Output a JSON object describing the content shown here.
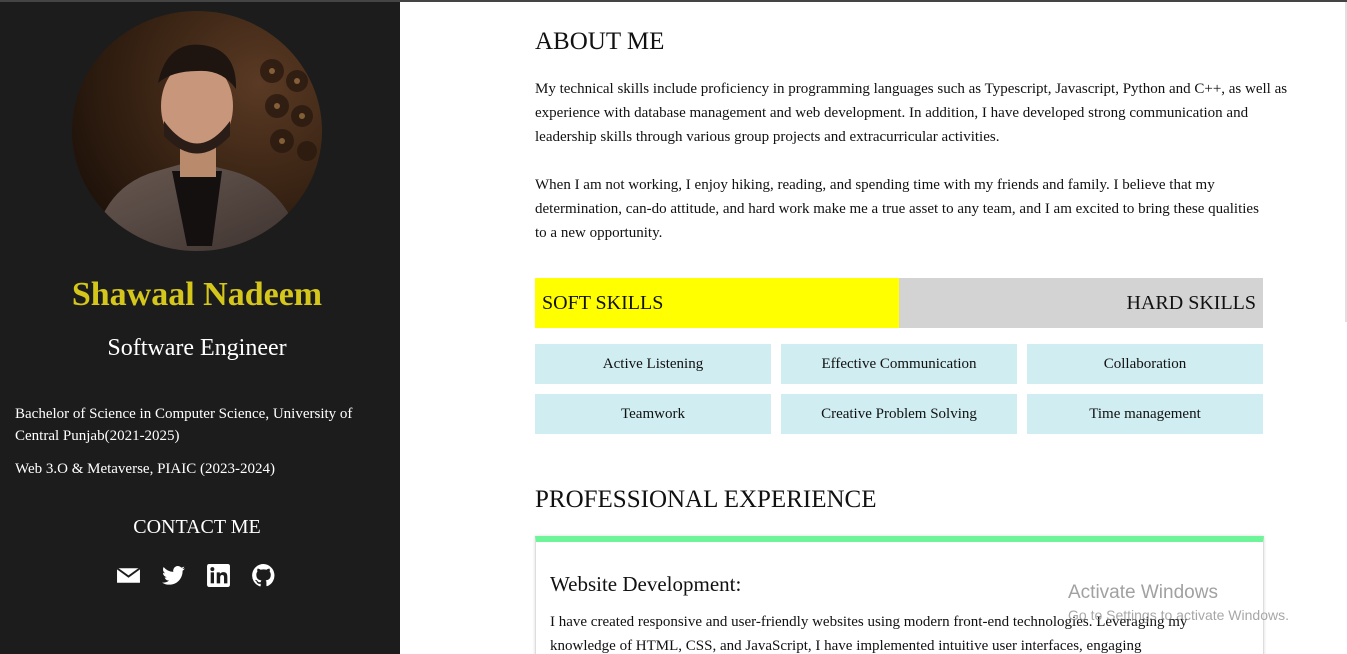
{
  "profile": {
    "name": "Shawaal Nadeem",
    "role": "Software Engineer",
    "education": [
      "Bachelor of Science in Computer Science, University of Central Punjab(2021-2025)",
      "Web 3.O & Metaverse, PIAIC (2023-2024)"
    ],
    "contact_title": "CONTACT ME",
    "social_icons": [
      "envelope-icon",
      "twitter-icon",
      "linkedin-icon",
      "github-icon"
    ]
  },
  "about": {
    "title": "ABOUT ME",
    "paragraphs": [
      "My technical skills include proficiency in programming languages such as Typescript, Javascript, Python and C++, as well as experience with database management and web development. In addition, I have developed strong communication and leadership skills through various group projects and extracurricular activities.",
      "When I am not working, I enjoy hiking, reading, and spending time with my friends and family. I believe that my determination, can-do attitude, and hard work make me a true asset to any team, and I am excited to bring these qualities to a new opportunity."
    ]
  },
  "skills": {
    "tabs": {
      "soft": "SOFT SKILLS",
      "hard": "HARD SKILLS"
    },
    "active_tab": "soft",
    "items": [
      "Active Listening",
      "Effective Communication",
      "Collaboration",
      "Teamwork",
      "Creative Problem Solving",
      "Time management"
    ]
  },
  "experience": {
    "title": "PROFESSIONAL EXPERIENCE",
    "cards": [
      {
        "title": "Website Development:",
        "text": "I have created responsive and user-friendly websites using modern front-end technologies. Leveraging my knowledge of HTML, CSS, and JavaScript, I have implemented intuitive user interfaces, engaging"
      }
    ]
  },
  "watermark": {
    "line1": "Activate Windows",
    "line2": "Go to Settings to activate Windows."
  },
  "colors": {
    "sidebar_bg": "#1c1c1c",
    "name_accent": "#d4c61a",
    "soft_tab": "#ffff00",
    "hard_tab": "#d3d3d3",
    "skill_bg": "#d0edf1",
    "card_accent": "#6ef59a"
  }
}
